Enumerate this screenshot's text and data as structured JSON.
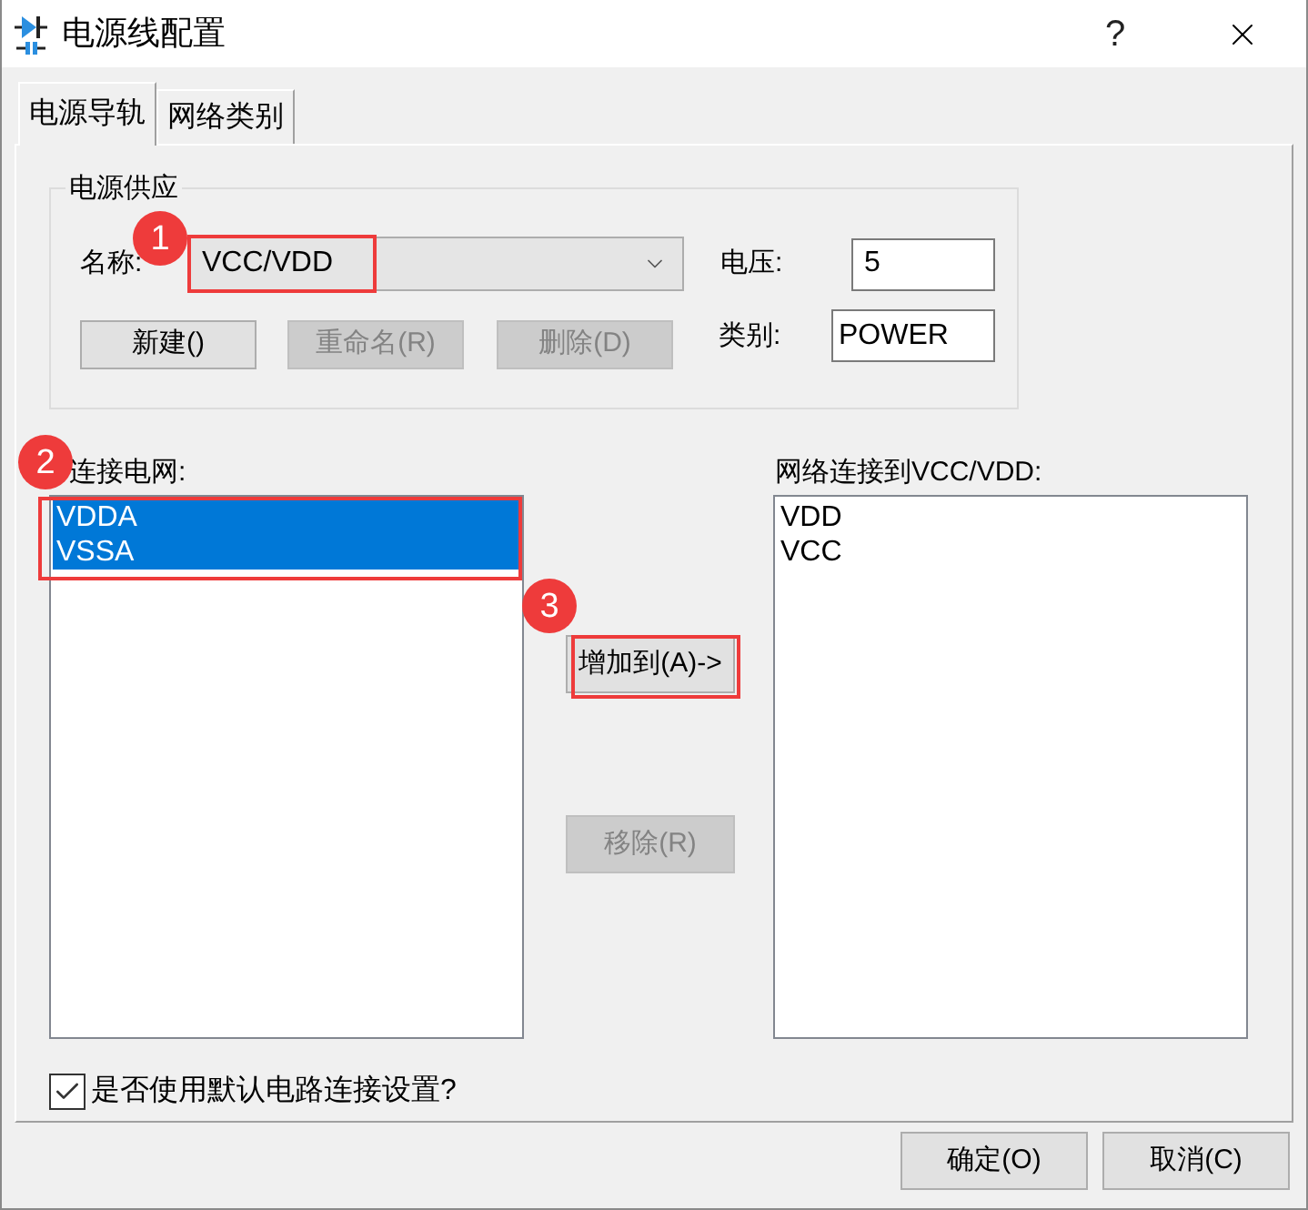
{
  "window": {
    "title": "电源线配置",
    "help": "?"
  },
  "tabs": [
    {
      "label": "电源导轨",
      "selected": true
    },
    {
      "label": "网络类别",
      "selected": false
    }
  ],
  "power_supply": {
    "title": "电源供应",
    "name_label": "名称:",
    "name_value": "VCC/VDD",
    "name_marker": "1",
    "voltage_label": "电压:",
    "voltage_value": "5",
    "class_label": "类别:",
    "class_value": "POWER",
    "buttons": [
      {
        "label": "新建()",
        "disabled": false
      },
      {
        "label": "重命名(R)",
        "disabled": true
      },
      {
        "label": "删除(D)",
        "disabled": true
      }
    ]
  },
  "unconnected_nets": {
    "label": "连接电网:",
    "marker": "2",
    "items": [
      {
        "label": "VDDA",
        "selected": true
      },
      {
        "label": "VSSA",
        "selected": true
      }
    ]
  },
  "add_button": {
    "label": "增加到(A)->",
    "disabled": false,
    "marker": "3"
  },
  "remove_button": {
    "label": "移除(R)",
    "disabled": true
  },
  "connected_nets": {
    "label": "网络连接到VCC/VDD:",
    "items": [
      {
        "label": "VDD",
        "selected": false
      },
      {
        "label": "VCC",
        "selected": false
      }
    ]
  },
  "default_checkbox": {
    "label": "是否使用默认电路连接设置?",
    "checked": true
  },
  "dialog_buttons": [
    "确定(O)",
    "取消(C)"
  ]
}
